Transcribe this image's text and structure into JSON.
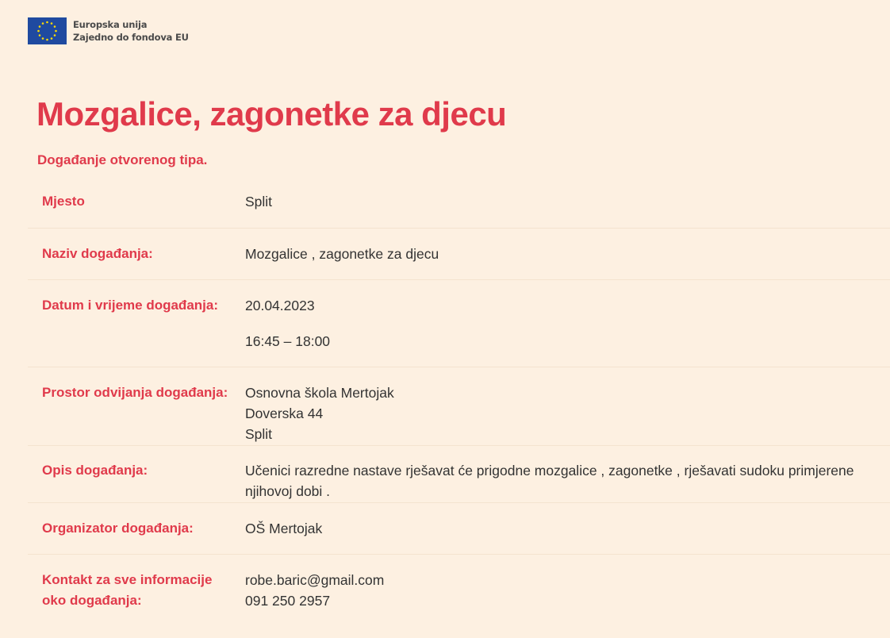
{
  "header": {
    "logo_line1": "Europska unija",
    "logo_line2": "Zajedno do fondova EU",
    "flag_color": "#1f4aa0",
    "star_color": "#ffdd00"
  },
  "title": "Mozgalice, zagonetke za djecu",
  "subtitle": "Događanje otvorenog tipa.",
  "details": [
    {
      "label": "Mjesto",
      "values": [
        "Split"
      ]
    },
    {
      "label": "Naziv događanja:",
      "values": [
        "Mozgalice , zagonetke za djecu"
      ]
    },
    {
      "label": "Datum i vrijeme događanja:",
      "values": [
        "20.04.2023",
        "16:45 – 18:00"
      ]
    },
    {
      "label": "Prostor odvijanja događanja:",
      "values": [
        "Osnovna škola Mertojak",
        "Doverska 44",
        "Split"
      ]
    },
    {
      "label": "Opis događanja:",
      "values": [
        "Učenici razredne nastave rješavat će prigodne mozgalice , zagonetke , rješavati sudoku primjerene njihovoj dobi ."
      ]
    },
    {
      "label": "Organizator događanja:",
      "values": [
        "OŠ Mertojak"
      ]
    },
    {
      "label": "Kontakt za sve informacije oko događanja:",
      "values": [
        "robe.baric@gmail.com",
        "091 250 2957"
      ]
    }
  ],
  "colors": {
    "accent": "#e03a4b",
    "background": "#fdf0e1",
    "text": "#333333"
  }
}
